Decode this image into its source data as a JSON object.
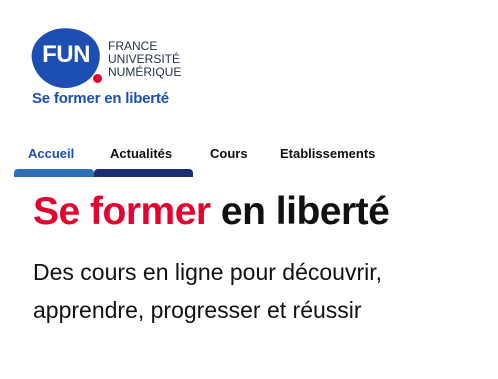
{
  "logo": {
    "brand": "FUN",
    "org_lines": [
      "FRANCE",
      "UNIVERSITÉ",
      "NUMÉRIQUE"
    ],
    "tagline": "Se former en liberté"
  },
  "nav": {
    "items": [
      {
        "label": "Accueil",
        "active": true
      },
      {
        "label": "Actualités",
        "active": false
      },
      {
        "label": "Cours",
        "active": false
      },
      {
        "label": "Etablissements",
        "active": false
      }
    ]
  },
  "hero": {
    "title_accent": "Se former",
    "title_rest": "en liberté",
    "subtitle_line1": "Des cours en ligne pour découvrir,",
    "subtitle_line2": "apprendre, progresser et réussir"
  },
  "colors": {
    "brand_blue": "#1d4fb2",
    "brand_red": "#e4032e",
    "navy": "#1b2f6e",
    "active_blue": "#2d6fb8"
  }
}
